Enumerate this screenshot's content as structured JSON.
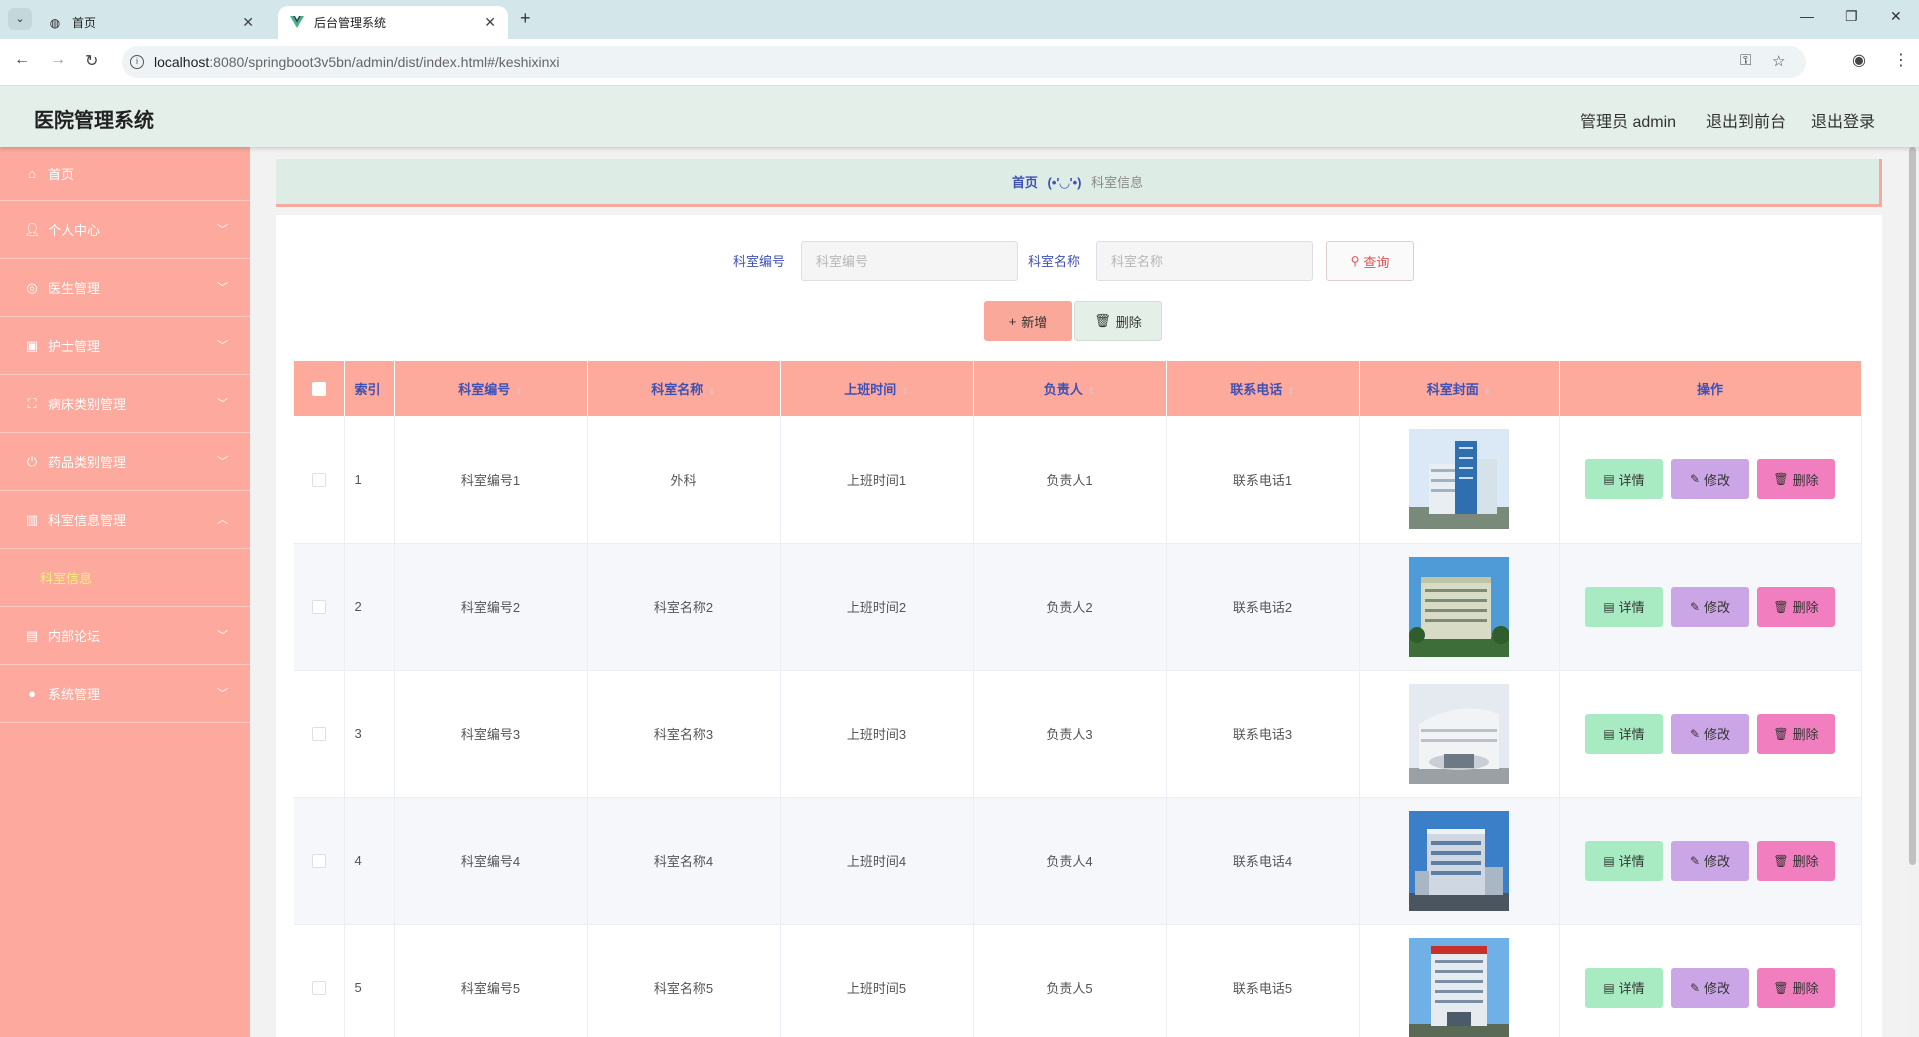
{
  "browser": {
    "tabs": [
      {
        "title": "首页",
        "icon": "globe-icon"
      },
      {
        "title": "后台管理系统",
        "icon": "vue-logo-icon"
      }
    ],
    "url_host": "localhost",
    "url_rest": ":8080/springboot3v5bn/admin/dist/index.html#/keshixinxi"
  },
  "header": {
    "title": "医院管理系统",
    "user": "管理员 admin",
    "to_front": "退出到前台",
    "logout": "退出登录"
  },
  "sidebar": {
    "items": [
      {
        "label": "首页",
        "icon": "home-icon",
        "expandable": false
      },
      {
        "label": "个人中心",
        "icon": "user-icon",
        "expandable": true
      },
      {
        "label": "医生管理",
        "icon": "doctor-icon",
        "expandable": true
      },
      {
        "label": "护士管理",
        "icon": "clipboard-icon",
        "expandable": true
      },
      {
        "label": "病床类别管理",
        "icon": "fullscreen-icon",
        "expandable": true
      },
      {
        "label": "药品类别管理",
        "icon": "power-icon",
        "expandable": true
      },
      {
        "label": "科室信息管理",
        "icon": "bar-chart-icon",
        "expandable": true,
        "expanded": true,
        "sub": [
          "科室信息"
        ]
      },
      {
        "label": "内部论坛",
        "icon": "briefcase-icon",
        "expandable": true
      },
      {
        "label": "系统管理",
        "icon": "location-icon",
        "expandable": true
      }
    ]
  },
  "breadcrumb": {
    "home": "首页",
    "separator": "(•'◡'•)",
    "current": "科室信息"
  },
  "search": {
    "label_code": "科室编号",
    "placeholder_code": "科室编号",
    "label_name": "科室名称",
    "placeholder_name": "科室名称",
    "button": "查询"
  },
  "actions": {
    "add": "新增",
    "delete": "删除"
  },
  "table": {
    "columns": [
      "索引",
      "科室编号",
      "科室名称",
      "上班时间",
      "负责人",
      "联系电话",
      "科室封面",
      "操作"
    ],
    "rows": [
      {
        "index": "1",
        "code": "科室编号1",
        "name": "外科",
        "time": "上班时间1",
        "head": "负责人1",
        "phone": "联系电话1"
      },
      {
        "index": "2",
        "code": "科室编号2",
        "name": "科室名称2",
        "time": "上班时间2",
        "head": "负责人2",
        "phone": "联系电话2"
      },
      {
        "index": "3",
        "code": "科室编号3",
        "name": "科室名称3",
        "time": "上班时间3",
        "head": "负责人3",
        "phone": "联系电话3"
      },
      {
        "index": "4",
        "code": "科室编号4",
        "name": "科室名称4",
        "time": "上班时间4",
        "head": "负责人4",
        "phone": "联系电话4"
      },
      {
        "index": "5",
        "code": "科室编号5",
        "name": "科室名称5",
        "time": "上班时间5",
        "head": "负责人5",
        "phone": "联系电话5"
      }
    ],
    "ops": {
      "detail": "详情",
      "edit": "修改",
      "delete": "删除"
    }
  },
  "colors": {
    "sidebar_bg": "#fda99d",
    "header_bg": "#e3efe8",
    "table_header_bg": "#fdaa9d",
    "accent_text": "#3f51b5",
    "detail_btn": "#a8ebc3",
    "edit_btn": "#cba6e6",
    "delete_btn": "#f17fbf"
  }
}
